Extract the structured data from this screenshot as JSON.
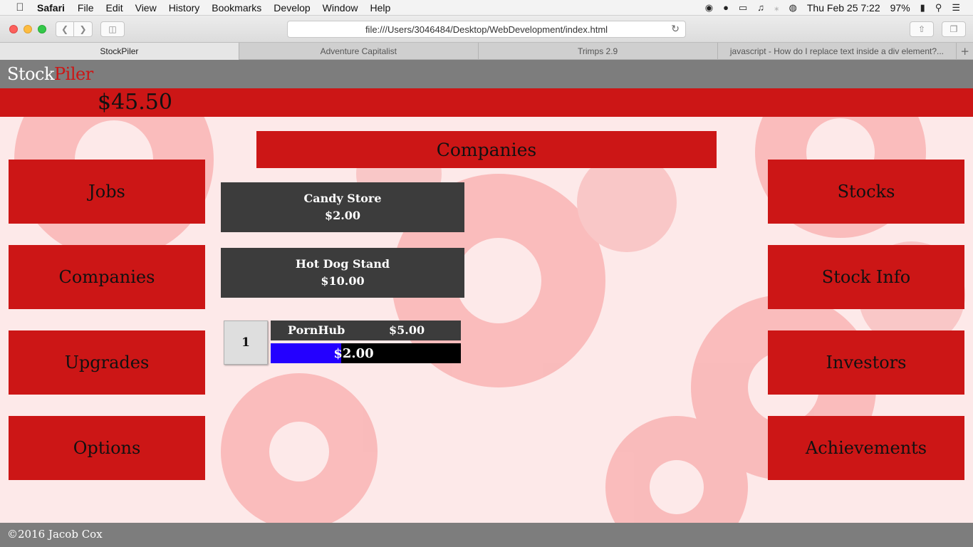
{
  "menubar": {
    "app": "Safari",
    "items": [
      "File",
      "Edit",
      "View",
      "History",
      "Bookmarks",
      "Develop",
      "Window",
      "Help"
    ],
    "datetime": "Thu Feb 25  7:22",
    "battery": "97%"
  },
  "browser": {
    "url": "file:///Users/3046484/Desktop/WebDevelopment/index.html",
    "tabs": [
      {
        "label": "StockPiler",
        "active": true
      },
      {
        "label": "Adventure Capitalist",
        "active": false
      },
      {
        "label": "Trimps 2.9",
        "active": false
      },
      {
        "label": "javascript - How do I replace text inside a div element?...",
        "active": false
      }
    ]
  },
  "site": {
    "logo_part1": "Stock",
    "logo_part2": "Piler",
    "money": "$45.50",
    "footer": "©2016 Jacob Cox"
  },
  "left_nav": [
    "Jobs",
    "Companies",
    "Upgrades",
    "Options"
  ],
  "right_nav": [
    "Stocks",
    "Stock Info",
    "Investors",
    "Achievements"
  ],
  "section_title": "Companies",
  "companies": [
    {
      "name": "Candy Store",
      "price": "$2.00"
    },
    {
      "name": "Hot Dog Stand",
      "price": "$10.00"
    }
  ],
  "owned_company": {
    "quantity": "1",
    "name": "PornHub",
    "price": "$5.00",
    "income": "$2.00",
    "progress": 0.37
  },
  "colors": {
    "brand_red": "#cc1616",
    "header_gray": "#7d7d7d",
    "card_dark": "#3c3c3c",
    "progress_fill": "#2400ff"
  }
}
